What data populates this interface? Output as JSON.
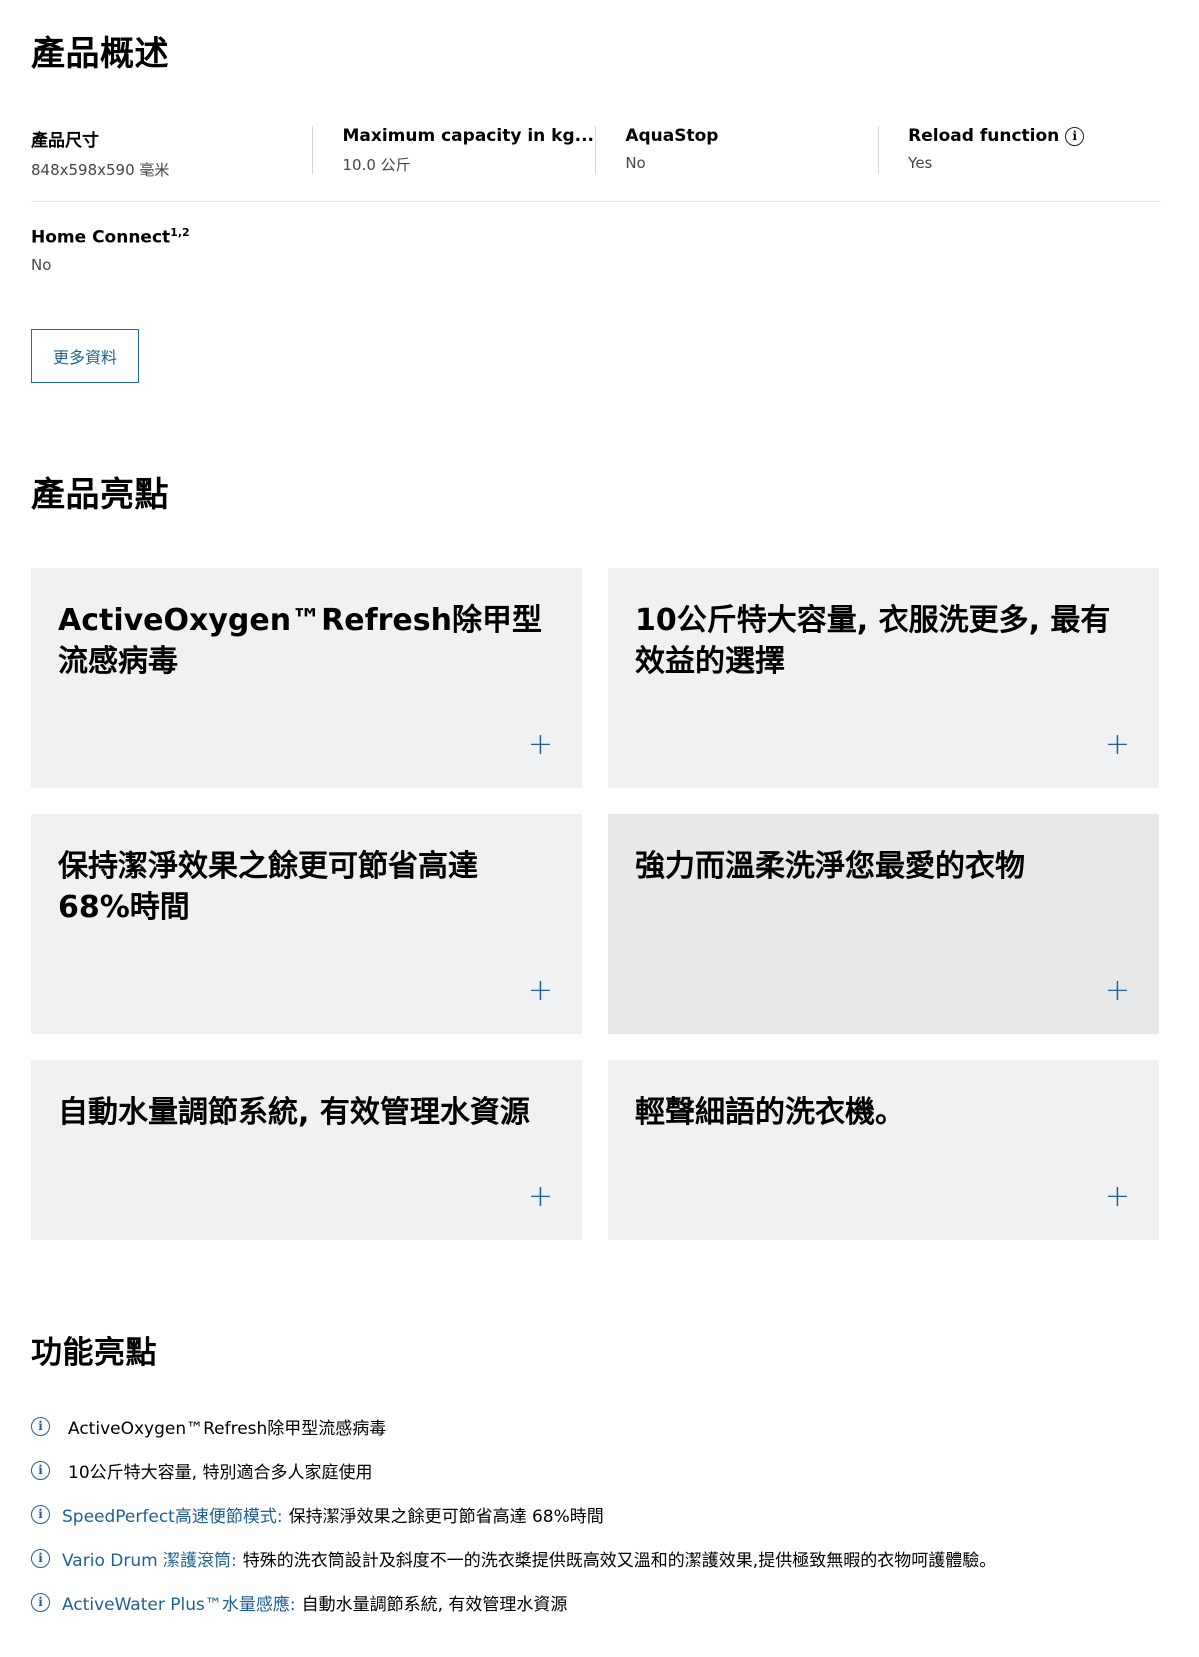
{
  "overview": {
    "title": "產品概述",
    "specs": [
      {
        "label": "產品尺寸",
        "value": "848x598x590 毫米"
      },
      {
        "label": "Maximum capacity in kg...",
        "value": "10.0 公斤"
      },
      {
        "label": "AquaStop",
        "value": "No"
      },
      {
        "label": "Reload function",
        "value": "Yes",
        "icon": "info-icon"
      }
    ],
    "home_connect": {
      "label": "Home Connect",
      "sup": "1,2",
      "value": "No"
    },
    "more_button": "更多資料"
  },
  "highlights": {
    "title": "產品亮點",
    "cards": [
      {
        "title": "ActiveOxygen™Refresh除甲型流感病毒"
      },
      {
        "title": "10公斤特大容量, 衣服洗更多, 最有效益的選擇"
      },
      {
        "title": "保持潔淨效果之餘更可節省高達 68%時間"
      },
      {
        "title": "強力而溫柔洗淨您最愛的衣物"
      },
      {
        "title": "自動水量調節系統, 有效管理水資源"
      },
      {
        "title": "輕聲細語的洗衣機。"
      }
    ],
    "plus_symbol": "+"
  },
  "features": {
    "title": "功能亮點",
    "items": [
      {
        "link": "",
        "text": "ActiveOxygen™Refresh除甲型流感病毒"
      },
      {
        "link": "",
        "text": "10公斤特大容量, 特別適合多人家庭使用"
      },
      {
        "link": "SpeedPerfect高速便節模式:",
        "text": "保持潔淨效果之餘更可節省高達 68%時間"
      },
      {
        "link": "Vario Drum 潔護滾筒:",
        "text": "特殊的洗衣筒設計及斜度不一的洗衣槳提供既高效又溫和的潔護效果,提供極致無暇的衣物呵護體驗。"
      },
      {
        "link": "ActiveWater Plus™水量感應:",
        "text": "自動水量調節系統, 有效管理水資源"
      }
    ],
    "icon_glyph": "i"
  },
  "colors": {
    "accent": "#1f5f95",
    "card_bg": "#eff1f2",
    "card_bg_dark": "#e7e8ea"
  }
}
